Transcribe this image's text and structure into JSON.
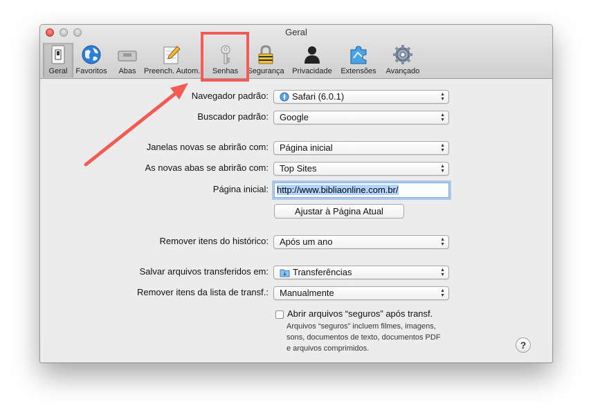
{
  "window": {
    "title": "Geral"
  },
  "toolbar": {
    "items": [
      {
        "label": "Geral",
        "icon": "toggle-switch-icon"
      },
      {
        "label": "Favoritos",
        "icon": "globe-icon"
      },
      {
        "label": "Abas",
        "icon": "tabs-icon"
      },
      {
        "label": "Preench. Autom.",
        "icon": "pencil-form-icon"
      },
      {
        "label": "Senhas",
        "icon": "key-icon"
      },
      {
        "label": "Segurança",
        "icon": "lock-icon"
      },
      {
        "label": "Privacidade",
        "icon": "person-silhouette-icon"
      },
      {
        "label": "Extensões",
        "icon": "puzzle-icon"
      },
      {
        "label": "Avançado",
        "icon": "gear-icon"
      }
    ]
  },
  "form": {
    "default_browser": {
      "label": "Navegador padrão:",
      "value": "Safari (6.0.1)"
    },
    "default_search": {
      "label": "Buscador padrão:",
      "value": "Google"
    },
    "new_windows": {
      "label": "Janelas novas se abrirão com:",
      "value": "Página inicial"
    },
    "new_tabs": {
      "label": "As novas abas se abrirão com:",
      "value": "Top Sites"
    },
    "homepage": {
      "label": "Página inicial:",
      "value": "http://www.bibliaonline.com.br/"
    },
    "set_current_button": "Ajustar à Página Atual",
    "remove_history": {
      "label": "Remover itens do histórico:",
      "value": "Após um ano"
    },
    "save_downloads": {
      "label": "Salvar arquivos transferidos em:",
      "value": "Transferências"
    },
    "remove_downloads": {
      "label": "Remover itens da lista de transf.:",
      "value": "Manualmente"
    },
    "open_safe": {
      "label": "Abrir arquivos “seguros” após transf.",
      "description": [
        "Arquivos “seguros” incluem filmes, imagens,",
        "sons, documentos de texto, documentos PDF",
        "e arquivos comprimidos."
      ]
    },
    "help_button": "?"
  },
  "colors": {
    "highlight": "#f25c54",
    "focus_ring": "#7eb0e6",
    "selection": "#b4d5fe"
  }
}
